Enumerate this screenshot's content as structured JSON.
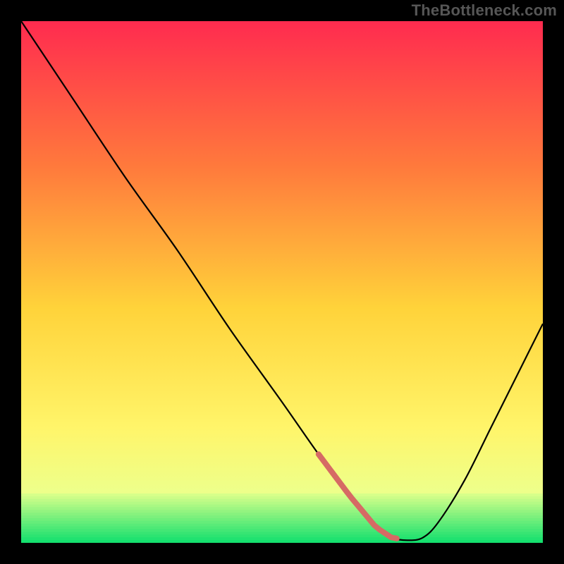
{
  "watermark": "TheBottleneck.com",
  "colors": {
    "gradient_top": "#ff2b4f",
    "gradient_mid_upper": "#ff7a3c",
    "gradient_mid": "#ffd33a",
    "gradient_mid_lower": "#fff56a",
    "gradient_lower": "#eeff8a",
    "curve": "#000000",
    "trough_segment": "#d66a64",
    "green_start": "#d7ff8a",
    "green_end": "#15e06e",
    "frame": "#000000"
  },
  "chart_data": {
    "type": "line",
    "title": "",
    "xlabel": "",
    "ylabel": "",
    "xlim": [
      0,
      100
    ],
    "ylim": [
      0,
      100
    ],
    "x": [
      0,
      4,
      10,
      20,
      30,
      40,
      50,
      57,
      63,
      68,
      71,
      74,
      77,
      80,
      85,
      90,
      95,
      100
    ],
    "values": [
      100,
      94,
      85,
      70,
      56,
      41,
      27,
      17,
      9,
      3,
      1,
      0.5,
      1,
      4,
      12,
      22,
      32,
      42
    ],
    "trough_region_x": [
      57,
      72
    ],
    "annotations": []
  }
}
